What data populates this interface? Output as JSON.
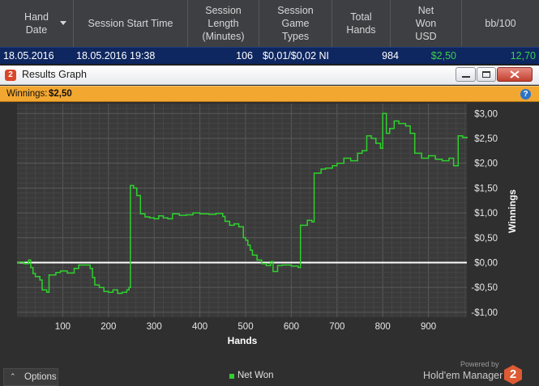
{
  "table": {
    "columns": [
      {
        "label": "Hand\nDate",
        "sort": "desc"
      },
      {
        "label": "Session Start Time"
      },
      {
        "label": "Session\nLength\n(Minutes)"
      },
      {
        "label": "Session\nGame\nTypes"
      },
      {
        "label": "Total\nHands"
      },
      {
        "label": "Net\nWon\nUSD"
      },
      {
        "label": "bb/100"
      }
    ],
    "row": {
      "hand_date": "18.05.2016",
      "start_time": "18.05.2016 19:38",
      "length": "106",
      "game_types": "$0,01/$0,02 NI",
      "total_hands": "984",
      "net_won": "$2,50",
      "bb100": "12,70"
    }
  },
  "window": {
    "icon_glyph": "2",
    "title": "Results Graph",
    "winnings_label": "Winnings:",
    "winnings_value": "$2,50",
    "help_glyph": "?"
  },
  "chart_data": {
    "type": "line",
    "xlabel": "Hands",
    "ylabel": "Winnings",
    "x_ticks": [
      "100",
      "200",
      "300",
      "400",
      "500",
      "600",
      "700",
      "800",
      "900"
    ],
    "y_ticks": [
      "$3,00",
      "$2,50",
      "$2,00",
      "$1,50",
      "$1,00",
      "$0,50",
      "$0,00",
      "-$0,50",
      "-$1,00"
    ],
    "xlim": [
      0,
      984
    ],
    "ylim": [
      -1.1,
      3.2
    ],
    "zero_line": true,
    "series": [
      {
        "name": "Net Won",
        "color": "#2ed12d",
        "points": [
          [
            0,
            0
          ],
          [
            5,
            0.01
          ],
          [
            15,
            -0.02
          ],
          [
            25,
            0.05
          ],
          [
            30,
            -0.1
          ],
          [
            35,
            -0.22
          ],
          [
            40,
            -0.28
          ],
          [
            50,
            -0.35
          ],
          [
            55,
            -0.55
          ],
          [
            65,
            -0.6
          ],
          [
            70,
            -0.25
          ],
          [
            85,
            -0.2
          ],
          [
            95,
            -0.17
          ],
          [
            110,
            -0.21
          ],
          [
            125,
            -0.12
          ],
          [
            135,
            -0.05
          ],
          [
            145,
            -0.05
          ],
          [
            155,
            -0.05
          ],
          [
            160,
            -0.12
          ],
          [
            165,
            -0.3
          ],
          [
            170,
            -0.45
          ],
          [
            180,
            -0.5
          ],
          [
            190,
            -0.58
          ],
          [
            200,
            -0.6
          ],
          [
            210,
            -0.55
          ],
          [
            220,
            -0.62
          ],
          [
            230,
            -0.6
          ],
          [
            240,
            -0.55
          ],
          [
            245,
            -0.5
          ],
          [
            248,
            1.55
          ],
          [
            255,
            1.5
          ],
          [
            262,
            1.35
          ],
          [
            270,
            0.98
          ],
          [
            280,
            0.92
          ],
          [
            290,
            0.9
          ],
          [
            300,
            0.88
          ],
          [
            310,
            0.94
          ],
          [
            320,
            0.9
          ],
          [
            330,
            0.88
          ],
          [
            340,
            0.98
          ],
          [
            355,
            0.95
          ],
          [
            370,
            0.96
          ],
          [
            385,
            1.0
          ],
          [
            400,
            0.98
          ],
          [
            420,
            0.97
          ],
          [
            435,
            0.99
          ],
          [
            450,
            0.93
          ],
          [
            455,
            0.83
          ],
          [
            465,
            0.75
          ],
          [
            475,
            0.78
          ],
          [
            485,
            0.72
          ],
          [
            495,
            0.5
          ],
          [
            500,
            0.45
          ],
          [
            505,
            0.35
          ],
          [
            510,
            0.25
          ],
          [
            515,
            0.15
          ],
          [
            525,
            0.05
          ],
          [
            535,
            -0.02
          ],
          [
            545,
            -0.06
          ],
          [
            555,
            0.02
          ],
          [
            560,
            -0.18
          ],
          [
            570,
            -0.06
          ],
          [
            580,
            -0.05
          ],
          [
            590,
            -0.05
          ],
          [
            600,
            -0.07
          ],
          [
            615,
            -0.1
          ],
          [
            620,
            0.75
          ],
          [
            635,
            0.85
          ],
          [
            645,
            0.82
          ],
          [
            650,
            1.8
          ],
          [
            665,
            1.88
          ],
          [
            675,
            1.9
          ],
          [
            690,
            1.95
          ],
          [
            700,
            2.0
          ],
          [
            715,
            2.1
          ],
          [
            730,
            2.05
          ],
          [
            745,
            2.2
          ],
          [
            755,
            2.25
          ],
          [
            765,
            2.55
          ],
          [
            775,
            2.5
          ],
          [
            785,
            2.4
          ],
          [
            795,
            2.3
          ],
          [
            800,
            3.0
          ],
          [
            808,
            2.6
          ],
          [
            815,
            2.7
          ],
          [
            825,
            2.85
          ],
          [
            835,
            2.8
          ],
          [
            850,
            2.75
          ],
          [
            860,
            2.6
          ],
          [
            870,
            2.2
          ],
          [
            885,
            2.1
          ],
          [
            900,
            2.15
          ],
          [
            915,
            2.08
          ],
          [
            930,
            2.05
          ],
          [
            945,
            2.1
          ],
          [
            955,
            1.95
          ],
          [
            965,
            2.55
          ],
          [
            975,
            2.52
          ],
          [
            984,
            2.5
          ]
        ]
      }
    ],
    "background": "#3a3a3a",
    "grid": true
  },
  "footer": {
    "options_caret": "⌃",
    "options_label": "Options",
    "legend_label": "Net Won",
    "powered_by": "Powered by",
    "brand_name": "Hold'em Manager",
    "brand_logo_glyph": "2"
  }
}
